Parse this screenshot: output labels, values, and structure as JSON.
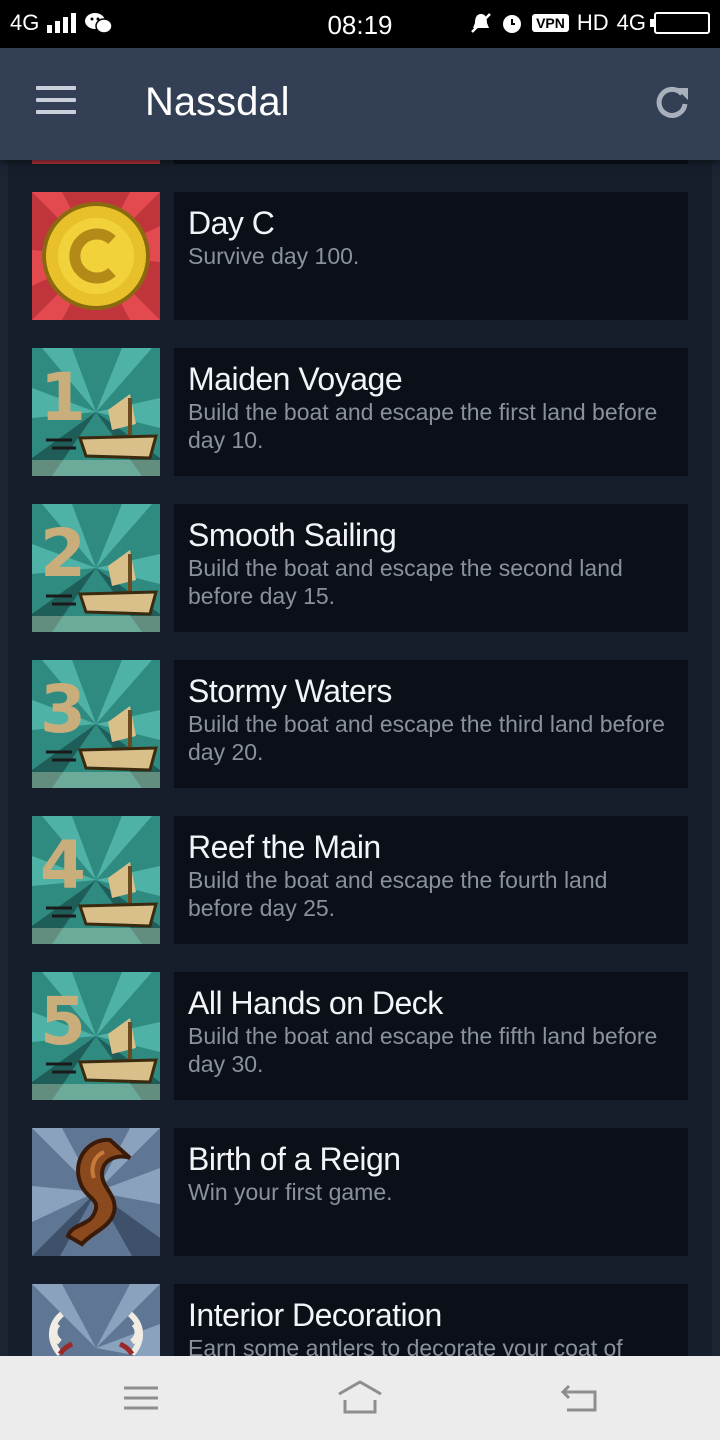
{
  "status_bar": {
    "network": "4G",
    "time": "08:19",
    "vpn": "VPN",
    "hd": "HD",
    "network_right": "4G"
  },
  "app_bar": {
    "title": "Nassdal",
    "menu_icon": "menu-icon",
    "refresh_icon": "refresh-icon"
  },
  "achievements": [
    {
      "title": "Day C",
      "description": "Survive day 100.",
      "icon": "gold-coin-c"
    },
    {
      "title": "Maiden Voyage",
      "description": "Build the boat and escape the first land before day 10.",
      "icon": "boat-1"
    },
    {
      "title": "Smooth Sailing",
      "description": "Build the boat and escape the second land before day 15.",
      "icon": "boat-2"
    },
    {
      "title": "Stormy Waters",
      "description": "Build the boat and escape the third land before day 20.",
      "icon": "boat-3"
    },
    {
      "title": "Reef the Main",
      "description": "Build the boat and escape the fourth land before day 25.",
      "icon": "boat-4"
    },
    {
      "title": "All Hands on Deck",
      "description": "Build the boat and escape the fifth land before day 30.",
      "icon": "boat-5"
    },
    {
      "title": "Birth of a Reign",
      "description": "Win your first game.",
      "icon": "crest-emblem"
    },
    {
      "title": "Interior Decoration",
      "description": "Earn some antlers to decorate your coat of",
      "icon": "antlers"
    }
  ],
  "icon_digits": [
    "1",
    "2",
    "3",
    "4",
    "5"
  ],
  "nav_bar": {
    "menu": "menu-icon",
    "home": "home-icon",
    "back": "back-icon"
  },
  "colors": {
    "app_bar": "#323f55",
    "list_bg": "#151e2a",
    "card_bg": "#0b1018",
    "title_text": "#f2f4f7",
    "desc_text": "#8a919c",
    "teal_icon": "#2f8a80",
    "gold": "#e8c12a",
    "red_icon": "#c0353c"
  }
}
